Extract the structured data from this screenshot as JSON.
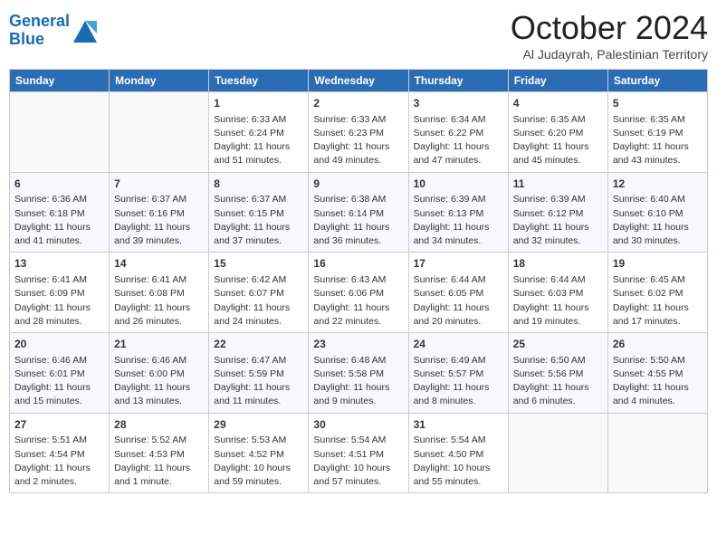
{
  "header": {
    "logo_line1": "General",
    "logo_line2": "Blue",
    "month": "October 2024",
    "location": "Al Judayrah, Palestinian Territory"
  },
  "days_of_week": [
    "Sunday",
    "Monday",
    "Tuesday",
    "Wednesday",
    "Thursday",
    "Friday",
    "Saturday"
  ],
  "weeks": [
    [
      {
        "day": "",
        "info": ""
      },
      {
        "day": "",
        "info": ""
      },
      {
        "day": "1",
        "info": "Sunrise: 6:33 AM\nSunset: 6:24 PM\nDaylight: 11 hours and 51 minutes."
      },
      {
        "day": "2",
        "info": "Sunrise: 6:33 AM\nSunset: 6:23 PM\nDaylight: 11 hours and 49 minutes."
      },
      {
        "day": "3",
        "info": "Sunrise: 6:34 AM\nSunset: 6:22 PM\nDaylight: 11 hours and 47 minutes."
      },
      {
        "day": "4",
        "info": "Sunrise: 6:35 AM\nSunset: 6:20 PM\nDaylight: 11 hours and 45 minutes."
      },
      {
        "day": "5",
        "info": "Sunrise: 6:35 AM\nSunset: 6:19 PM\nDaylight: 11 hours and 43 minutes."
      }
    ],
    [
      {
        "day": "6",
        "info": "Sunrise: 6:36 AM\nSunset: 6:18 PM\nDaylight: 11 hours and 41 minutes."
      },
      {
        "day": "7",
        "info": "Sunrise: 6:37 AM\nSunset: 6:16 PM\nDaylight: 11 hours and 39 minutes."
      },
      {
        "day": "8",
        "info": "Sunrise: 6:37 AM\nSunset: 6:15 PM\nDaylight: 11 hours and 37 minutes."
      },
      {
        "day": "9",
        "info": "Sunrise: 6:38 AM\nSunset: 6:14 PM\nDaylight: 11 hours and 36 minutes."
      },
      {
        "day": "10",
        "info": "Sunrise: 6:39 AM\nSunset: 6:13 PM\nDaylight: 11 hours and 34 minutes."
      },
      {
        "day": "11",
        "info": "Sunrise: 6:39 AM\nSunset: 6:12 PM\nDaylight: 11 hours and 32 minutes."
      },
      {
        "day": "12",
        "info": "Sunrise: 6:40 AM\nSunset: 6:10 PM\nDaylight: 11 hours and 30 minutes."
      }
    ],
    [
      {
        "day": "13",
        "info": "Sunrise: 6:41 AM\nSunset: 6:09 PM\nDaylight: 11 hours and 28 minutes."
      },
      {
        "day": "14",
        "info": "Sunrise: 6:41 AM\nSunset: 6:08 PM\nDaylight: 11 hours and 26 minutes."
      },
      {
        "day": "15",
        "info": "Sunrise: 6:42 AM\nSunset: 6:07 PM\nDaylight: 11 hours and 24 minutes."
      },
      {
        "day": "16",
        "info": "Sunrise: 6:43 AM\nSunset: 6:06 PM\nDaylight: 11 hours and 22 minutes."
      },
      {
        "day": "17",
        "info": "Sunrise: 6:44 AM\nSunset: 6:05 PM\nDaylight: 11 hours and 20 minutes."
      },
      {
        "day": "18",
        "info": "Sunrise: 6:44 AM\nSunset: 6:03 PM\nDaylight: 11 hours and 19 minutes."
      },
      {
        "day": "19",
        "info": "Sunrise: 6:45 AM\nSunset: 6:02 PM\nDaylight: 11 hours and 17 minutes."
      }
    ],
    [
      {
        "day": "20",
        "info": "Sunrise: 6:46 AM\nSunset: 6:01 PM\nDaylight: 11 hours and 15 minutes."
      },
      {
        "day": "21",
        "info": "Sunrise: 6:46 AM\nSunset: 6:00 PM\nDaylight: 11 hours and 13 minutes."
      },
      {
        "day": "22",
        "info": "Sunrise: 6:47 AM\nSunset: 5:59 PM\nDaylight: 11 hours and 11 minutes."
      },
      {
        "day": "23",
        "info": "Sunrise: 6:48 AM\nSunset: 5:58 PM\nDaylight: 11 hours and 9 minutes."
      },
      {
        "day": "24",
        "info": "Sunrise: 6:49 AM\nSunset: 5:57 PM\nDaylight: 11 hours and 8 minutes."
      },
      {
        "day": "25",
        "info": "Sunrise: 6:50 AM\nSunset: 5:56 PM\nDaylight: 11 hours and 6 minutes."
      },
      {
        "day": "26",
        "info": "Sunrise: 5:50 AM\nSunset: 4:55 PM\nDaylight: 11 hours and 4 minutes."
      }
    ],
    [
      {
        "day": "27",
        "info": "Sunrise: 5:51 AM\nSunset: 4:54 PM\nDaylight: 11 hours and 2 minutes."
      },
      {
        "day": "28",
        "info": "Sunrise: 5:52 AM\nSunset: 4:53 PM\nDaylight: 11 hours and 1 minute."
      },
      {
        "day": "29",
        "info": "Sunrise: 5:53 AM\nSunset: 4:52 PM\nDaylight: 10 hours and 59 minutes."
      },
      {
        "day": "30",
        "info": "Sunrise: 5:54 AM\nSunset: 4:51 PM\nDaylight: 10 hours and 57 minutes."
      },
      {
        "day": "31",
        "info": "Sunrise: 5:54 AM\nSunset: 4:50 PM\nDaylight: 10 hours and 55 minutes."
      },
      {
        "day": "",
        "info": ""
      },
      {
        "day": "",
        "info": ""
      }
    ]
  ]
}
